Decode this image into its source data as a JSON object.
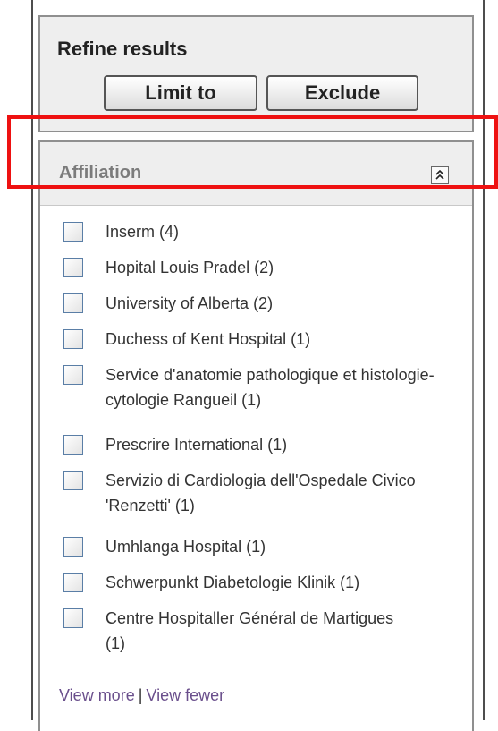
{
  "refine": {
    "title": "Refine results",
    "limit_label": "Limit to",
    "exclude_label": "Exclude"
  },
  "affiliation": {
    "title": "Affiliation",
    "collapse_glyph": "˄",
    "items": [
      {
        "label": "Inserm (4)"
      },
      {
        "label": "Hopital Louis Pradel (2)"
      },
      {
        "label": "University of Alberta (2)"
      },
      {
        "label": "Duchess of Kent Hospital (1)"
      },
      {
        "label": "Service d'anatomie pathologique et histologie-cytologie Rangueil (1)"
      },
      {
        "label": "Prescrire International (1)"
      },
      {
        "label": "Servizio di Cardiologia dell'Ospedale Civico 'Renzetti' (1)"
      },
      {
        "label": "Umhlanga Hospital (1)"
      },
      {
        "label": "Schwerpunkt Diabetologie Klinik (1)"
      },
      {
        "label": "Centre Hospitaller Général de Martigues (1)"
      }
    ],
    "view_more": "View more",
    "separator": "|",
    "view_fewer": "View fewer"
  },
  "colors": {
    "highlight": "#ee1111",
    "link": "#6a4f8c",
    "header_text": "#7b7b7b"
  }
}
